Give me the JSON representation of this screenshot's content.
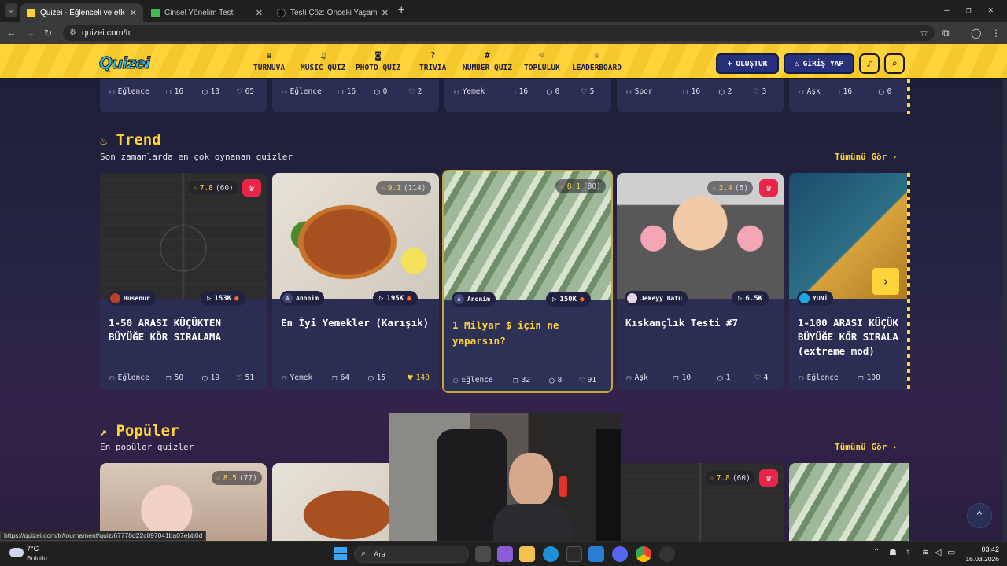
{
  "browser": {
    "tabs": [
      {
        "title": "Quizei - Eğlenceli ve etkileşimli",
        "active": true,
        "favicon_color": "#ffd43b"
      },
      {
        "title": "Cinsel Yönelim Testi",
        "active": false,
        "favicon_color": "#3fb950"
      },
      {
        "title": "Testi Çöz: Önceki Yaşamındaki",
        "active": false,
        "favicon_color": "#111111"
      }
    ],
    "url": "quizei.com/tr",
    "new_tab": "+",
    "close": "✕"
  },
  "site": {
    "logo": "Quizei",
    "nav": [
      {
        "label": "TURNUVA",
        "icon": "trophy-icon",
        "glyph": "♛"
      },
      {
        "label": "MUSIC QUIZ",
        "icon": "music-icon",
        "glyph": "♫"
      },
      {
        "label": "PHOTO QUIZ",
        "icon": "camera-icon",
        "glyph": "◙"
      },
      {
        "label": "TRIVIA",
        "icon": "chat-icon",
        "glyph": "?"
      },
      {
        "label": "NUMBER QUIZ",
        "icon": "hash-icon",
        "glyph": "#"
      },
      {
        "label": "TOPLULUK",
        "icon": "users-icon",
        "glyph": "☺"
      },
      {
        "label": "LEADERBOARD",
        "icon": "medal-icon",
        "glyph": "♕"
      }
    ],
    "create_label": "OLUŞTUR",
    "login_label": "GİRİŞ YAP"
  },
  "top_row": [
    {
      "category": "Eğlence",
      "q": "16",
      "c": "13",
      "l": "65"
    },
    {
      "category": "Eğlence",
      "q": "16",
      "c": "0",
      "l": "2"
    },
    {
      "category": "Yemek",
      "q": "16",
      "c": "0",
      "l": "5"
    },
    {
      "category": "Spor",
      "q": "16",
      "c": "2",
      "l": "3"
    },
    {
      "category": "Aşk",
      "q": "16",
      "c": "0",
      "l": ""
    }
  ],
  "trend": {
    "title": "Trend",
    "subtitle": "Son zamanlarda en çok oynanan quizler",
    "see_all": "Tümünü Gör ›",
    "cards": [
      {
        "rating": "7.8",
        "rating_count": "(60)",
        "author": "Busenur",
        "plays": "153K",
        "title": "1-50 ARASI KÜÇÜKTEN BÜYÜĞE KÖR SIRALAMA",
        "category": "Eğlence",
        "q": "50",
        "c": "19",
        "l": "51"
      },
      {
        "rating": "9.1",
        "rating_count": "(114)",
        "author": "Anonim",
        "plays": "195K",
        "title": "En İyi Yemekler (Karışık)",
        "category": "Yemek",
        "q": "64",
        "c": "15",
        "l": "140"
      },
      {
        "rating": "8.1",
        "rating_count": "(80)",
        "author": "Anonim",
        "plays": "150K",
        "title": "1 Milyar $ için ne yaparsın?",
        "category": "Eğlence",
        "q": "32",
        "c": "8",
        "l": "91"
      },
      {
        "rating": "2.4",
        "rating_count": "(5)",
        "author": "Jekeyy Batu",
        "plays": "6.5K",
        "title": "Kıskançlık Testi #7",
        "category": "Aşk",
        "q": "10",
        "c": "1",
        "l": "4"
      },
      {
        "rating": "",
        "rating_count": "",
        "author": "YUNİ",
        "plays": "",
        "title": "1-100 ARASI KÜÇÜK BÜYÜĞE KÖR SIRALA (extreme mod)",
        "category": "Eğlence",
        "q": "100",
        "c": "",
        "l": ""
      }
    ]
  },
  "popular": {
    "title": "Popüler",
    "subtitle": "En popüler quizler",
    "see_all": "Tümünü Gör ›",
    "cards": [
      {
        "rating": "8.5",
        "rating_count": "(77)"
      },
      {
        "rating": "",
        "rating_count": ""
      },
      {
        "rating": "7.8",
        "rating_count": "(60)"
      },
      {
        "rating": "",
        "rating_count": ""
      }
    ]
  },
  "status_url": "https://quizei.com/tr/tournament/quiz/67778d22c097041ba07ebb0d",
  "taskbar": {
    "weather_temp": "7°C",
    "weather_desc": "Bulutlu",
    "search_placeholder": "Ara",
    "time": "03:42",
    "date": "16.03.2026"
  }
}
